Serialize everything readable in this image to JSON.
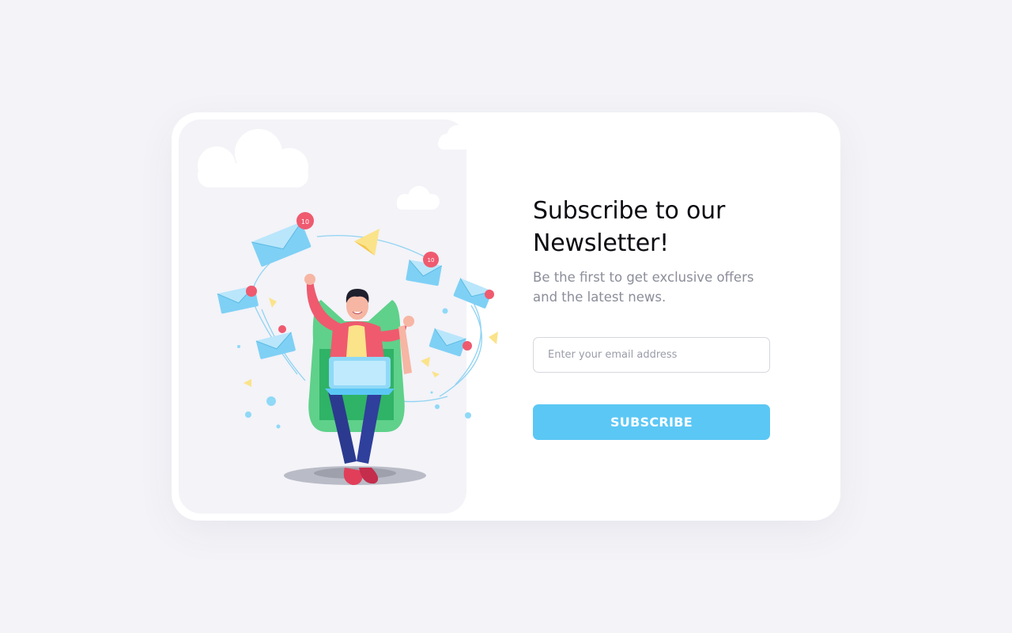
{
  "newsletter": {
    "title": "Subscribe to our Newsletter!",
    "subtitle": "Be the first to get exclusive offers and the latest news.",
    "email_placeholder": "Enter your email address",
    "email_value": "",
    "subscribe_label": "SUBSCRIBE"
  },
  "illustration": {
    "badge_number": "10",
    "icons": [
      "cloud-icon",
      "envelope-icon",
      "paper-plane-icon",
      "notification-badge-icon",
      "person-with-laptop"
    ]
  },
  "colors": {
    "accent": "#5bc7f5",
    "background": "#f4f4f8",
    "card": "#ffffff",
    "panel": "#f3f3f8",
    "title": "#0c0c12",
    "subtitle": "#8b8d99"
  }
}
